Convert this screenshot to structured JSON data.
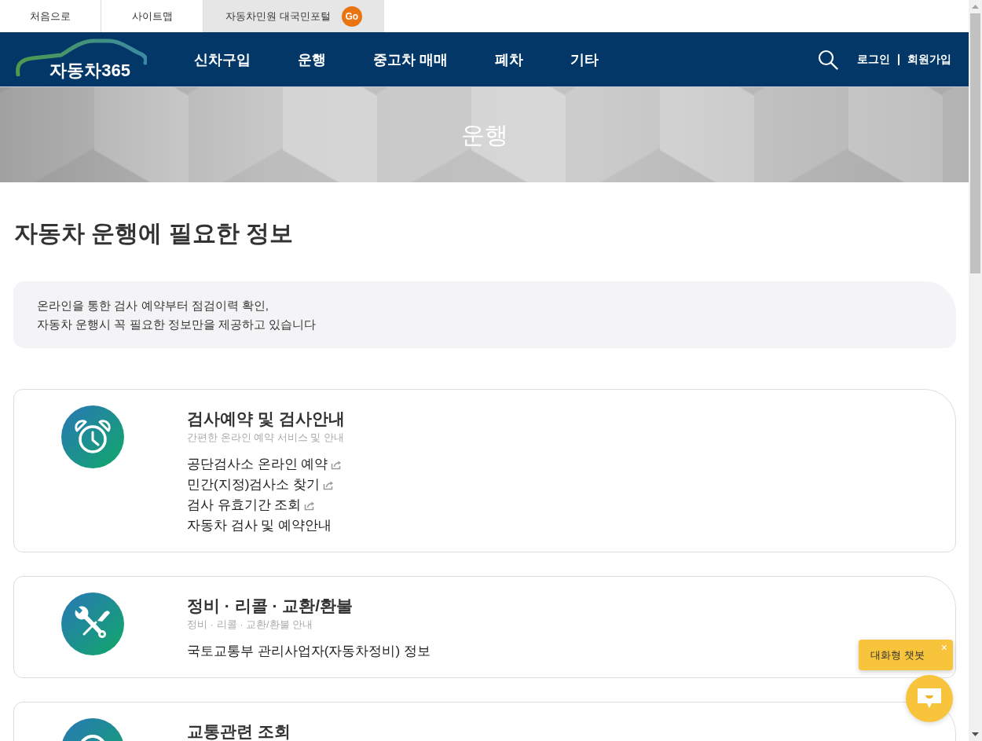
{
  "top_links": [
    {
      "label": "처음으로",
      "kind": "plain"
    },
    {
      "label": "사이트맵",
      "kind": "plain"
    },
    {
      "label": "자동차민원 대국민포털",
      "kind": "portal",
      "badge": "Go"
    }
  ],
  "header": {
    "logo": "자동차365",
    "nav": [
      "신차구입",
      "운행",
      "중고차 매매",
      "폐차",
      "기타"
    ],
    "account_links": [
      "로그인",
      "회원가입"
    ]
  },
  "hero": {
    "title": "운행"
  },
  "heading": "자동차 운행에 필요한 정보",
  "intro": [
    "온라인을 통한 검사 예약부터 점검이력 확인,",
    "자동차 운행시 꼭 필요한 정보만을 제공하고 있습니다"
  ],
  "cards": [
    {
      "kind": "inspection",
      "title": "검사예약 및 검사안내",
      "subtitle": "간편한 온라인 예약 서비스 및 안내",
      "links": [
        {
          "label": "공단검사소 온라인 예약",
          "external": true
        },
        {
          "label": "민간(지정)검사소 찾기",
          "external": true
        },
        {
          "label": "검사 유효기간 조회",
          "external": true
        },
        {
          "label": "자동차 검사 및 예약안내",
          "external": false
        }
      ]
    },
    {
      "kind": "repair",
      "title": "정비 · 리콜 · 교환/환불",
      "subtitle": "정비 · 리콜 · 교환/환불 안내",
      "links": [
        {
          "label": "국토교통부 관리사업자(자동차정비) 정보",
          "external": false
        }
      ]
    },
    {
      "kind": "lookup",
      "title": "교통관련 조회"
    }
  ],
  "chatbot": {
    "tooltip": "대화형 챗봇",
    "close": "×"
  }
}
